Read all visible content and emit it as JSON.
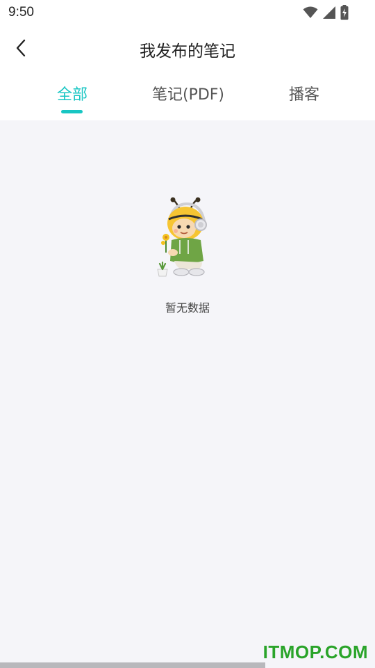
{
  "status_bar": {
    "time": "9:50",
    "icons": [
      "wifi-icon",
      "cellular-signal-icon",
      "battery-charging-icon"
    ]
  },
  "header": {
    "title": "我发布的笔记",
    "back_icon": "chevron-left-icon"
  },
  "tabs": [
    {
      "label": "全部",
      "active": true
    },
    {
      "label": "笔记(PDF)",
      "active": false
    },
    {
      "label": "播客",
      "active": false
    }
  ],
  "empty_state": {
    "illustration": "bee-mascot-illustration",
    "message": "暂无数据"
  },
  "watermark": "ITMOP.COM",
  "colors": {
    "accent": "#18c6c3",
    "background": "#f5f5f9",
    "header_bg": "#ffffff",
    "watermark": "#2aa42a"
  }
}
